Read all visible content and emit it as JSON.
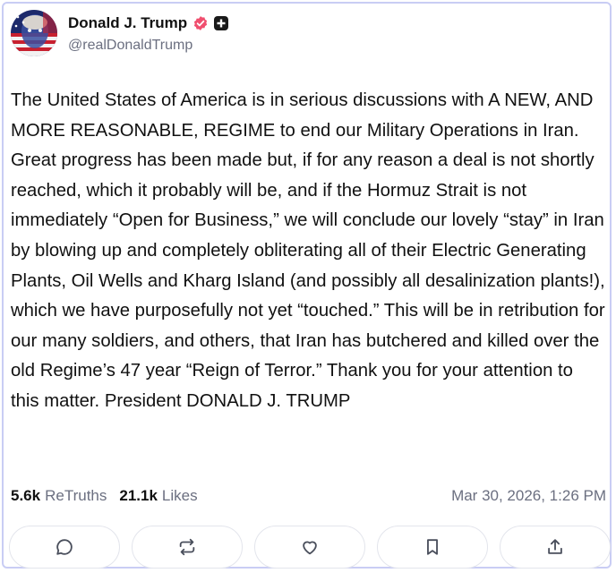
{
  "author": {
    "display_name": "Donald J. Trump",
    "handle": "@realDonaldTrump",
    "avatar_icon": "avatar-flag-portrait",
    "verified_icon": "verified-badge-icon",
    "plus_icon": "plus-badge-icon"
  },
  "post": {
    "text": "The United States of America is in serious discussions with A NEW, AND MORE REASONABLE, REGIME to end our Military Operations in Iran. Great progress has been made but, if for any reason a deal is not shortly reached, which it probably will be, and if the Hormuz Strait is not immediately “Open for Business,” we will conclude our lovely “stay” in Iran by blowing up and completely obliterating all of their Electric Generating Plants, Oil Wells and Kharg Island (and possibly all desalinization plants!), which we have purposefully not yet “touched.” This will be in retribution for our many soldiers, and others, that Iran has butchered and killed over the old Regime’s 47 year “Reign of Terror.” Thank you for your attention to this matter. President DONALD J. TRUMP"
  },
  "stats": {
    "retruths_count": "5.6k",
    "retruths_label": "ReTruths",
    "likes_count": "21.1k",
    "likes_label": "Likes"
  },
  "timestamp": "Mar 30, 2026, 1:26 PM",
  "actions": [
    {
      "name": "reply",
      "icon": "comment-icon"
    },
    {
      "name": "retruth",
      "icon": "repost-icon"
    },
    {
      "name": "like",
      "icon": "heart-icon"
    },
    {
      "name": "bookmark",
      "icon": "bookmark-icon"
    },
    {
      "name": "share",
      "icon": "share-icon"
    }
  ],
  "colors": {
    "verified": "#f04f6f",
    "border": "#c9cdf4",
    "muted_text": "#6b6f80",
    "action_border": "#e3e5ec",
    "icon": "#4a4f5c"
  }
}
